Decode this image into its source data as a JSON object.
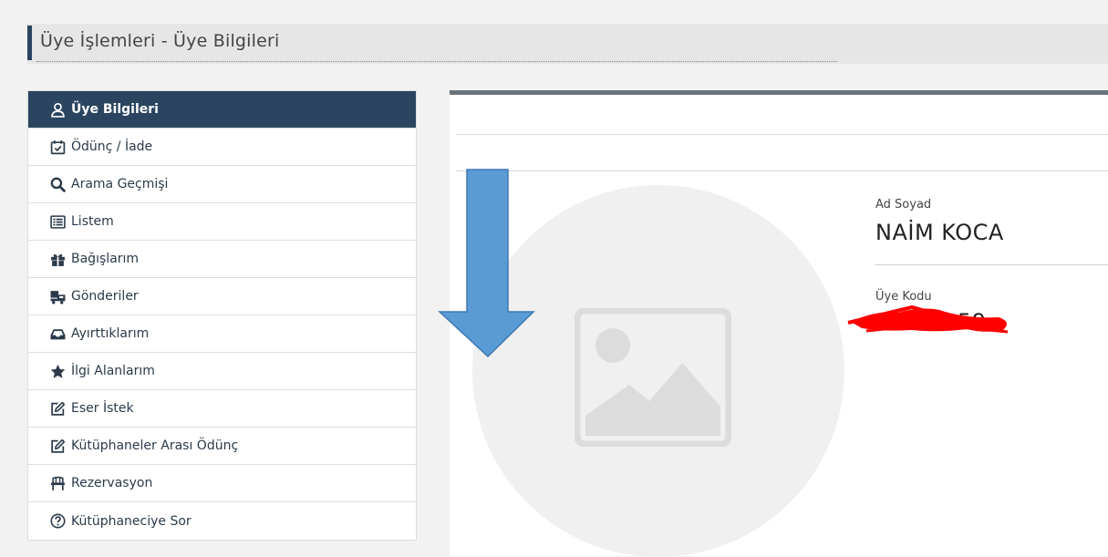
{
  "header": {
    "title": "Üye İşlemleri - Üye Bilgileri"
  },
  "sidebar": {
    "items": [
      {
        "label": "Üye Bilgileri",
        "icon": "user-icon"
      },
      {
        "label": "Ödünç / İade",
        "icon": "calendar-check-icon"
      },
      {
        "label": "Arama Geçmişi",
        "icon": "search-icon"
      },
      {
        "label": "Listem",
        "icon": "list-icon"
      },
      {
        "label": "Bağışlarım",
        "icon": "gift-icon"
      },
      {
        "label": "Gönderiler",
        "icon": "shipping-icon"
      },
      {
        "label": "Ayırttıklarım",
        "icon": "inbox-icon"
      },
      {
        "label": "İlgi Alanlarım",
        "icon": "star-icon"
      },
      {
        "label": "Eser İstek",
        "icon": "edit-icon"
      },
      {
        "label": "Kütüphaneler Arası Ödünç",
        "icon": "edit-icon"
      },
      {
        "label": "Rezervasyon",
        "icon": "chair-icon"
      },
      {
        "label": "Kütüphaneciye Sor",
        "icon": "question-icon"
      }
    ]
  },
  "profile": {
    "name_label": "Ad Soyad",
    "name_value": "NAİM KOCA",
    "code_label": "Üye Kodu",
    "code_value": "59"
  },
  "colors": {
    "sidebar_active": "#2b4560",
    "arrow": "#5b9bd5",
    "redaction": "#ff0000"
  }
}
